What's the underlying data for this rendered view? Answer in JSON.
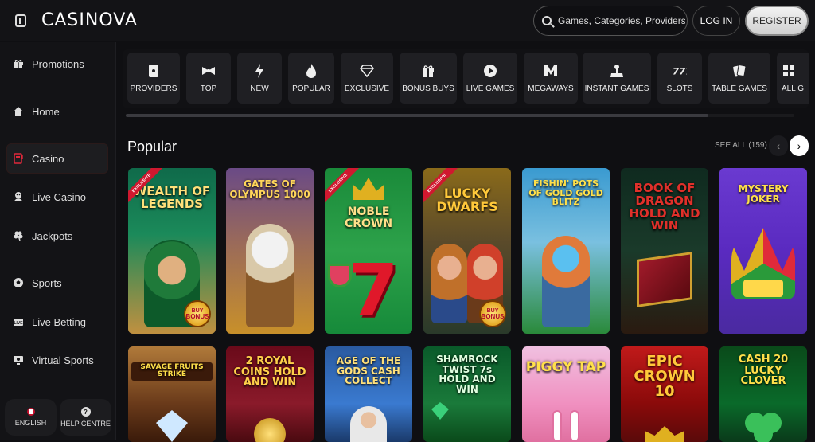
{
  "header": {
    "logo": "CASINOVA",
    "search_placeholder": "Games, Categories, Providers",
    "login_label": "LOG IN",
    "register_label": "REGISTER"
  },
  "sidebar": {
    "items": [
      {
        "label": "Promotions",
        "icon": "gift-icon"
      },
      {
        "label": "Home",
        "icon": "home-icon"
      },
      {
        "label": "Casino",
        "icon": "slot-machine-icon",
        "active": true
      },
      {
        "label": "Live Casino",
        "icon": "croupier-icon"
      },
      {
        "label": "Jackpots",
        "icon": "clover-icon"
      },
      {
        "label": "Sports",
        "icon": "soccer-ball-icon"
      },
      {
        "label": "Live Betting",
        "icon": "live-icon"
      },
      {
        "label": "Virtual Sports",
        "icon": "virtual-sports-icon"
      }
    ],
    "language_label": "ENGLISH",
    "help_label": "HELP CENTRE"
  },
  "categories": [
    {
      "label": "PROVIDERS",
      "icon": "providers-icon"
    },
    {
      "label": "TOP",
      "icon": "bowtie-icon"
    },
    {
      "label": "NEW",
      "icon": "lightning-icon"
    },
    {
      "label": "POPULAR",
      "icon": "flame-icon"
    },
    {
      "label": "EXCLUSIVE",
      "icon": "diamond-icon"
    },
    {
      "label": "BONUS BUYS",
      "icon": "gift-box-icon"
    },
    {
      "label": "LIVE GAMES",
      "icon": "play-icon"
    },
    {
      "label": "MEGAWAYS",
      "icon": "megaways-icon"
    },
    {
      "label": "INSTANT GAMES",
      "icon": "joystick-icon"
    },
    {
      "label": "SLOTS",
      "icon": "sevens-icon"
    },
    {
      "label": "TABLE GAMES",
      "icon": "cards-icon"
    },
    {
      "label": "ALL G",
      "icon": "all-games-icon"
    }
  ],
  "popular": {
    "title": "Popular",
    "see_all": "SEE ALL (159)",
    "badge_exclusive": "EXCLUSIVE",
    "buy_bonus_top": "BUY",
    "buy_bonus_bottom": "BONUS",
    "games_row1": [
      {
        "name": "WEALTH OF LEGENDS",
        "exclusive": true,
        "buy_bonus": true
      },
      {
        "name": "GATES OF OLYMPUS 1000"
      },
      {
        "name": "NOBLE CROWN",
        "exclusive": true
      },
      {
        "name": "LUCKY DWARFS",
        "exclusive": true,
        "buy_bonus": true
      },
      {
        "name": "FISHIN' POTS OF GOLD GOLD BLITZ"
      },
      {
        "name": "BOOK OF DRAGON HOLD AND WIN"
      },
      {
        "name": "MYSTERY JOKER"
      }
    ],
    "games_row2": [
      {
        "name": "SAVAGE FRUITS STRIKE"
      },
      {
        "name": "2 ROYAL COINS HOLD AND WIN"
      },
      {
        "name": "AGE OF THE GODS CASH COLLECT"
      },
      {
        "name": "SHAMROCK TWIST 7s HOLD AND WIN"
      },
      {
        "name": "PIGGY TAP"
      },
      {
        "name": "EPIC CROWN 10"
      },
      {
        "name": "CASH 20 LUCKY CLOVER"
      }
    ]
  }
}
